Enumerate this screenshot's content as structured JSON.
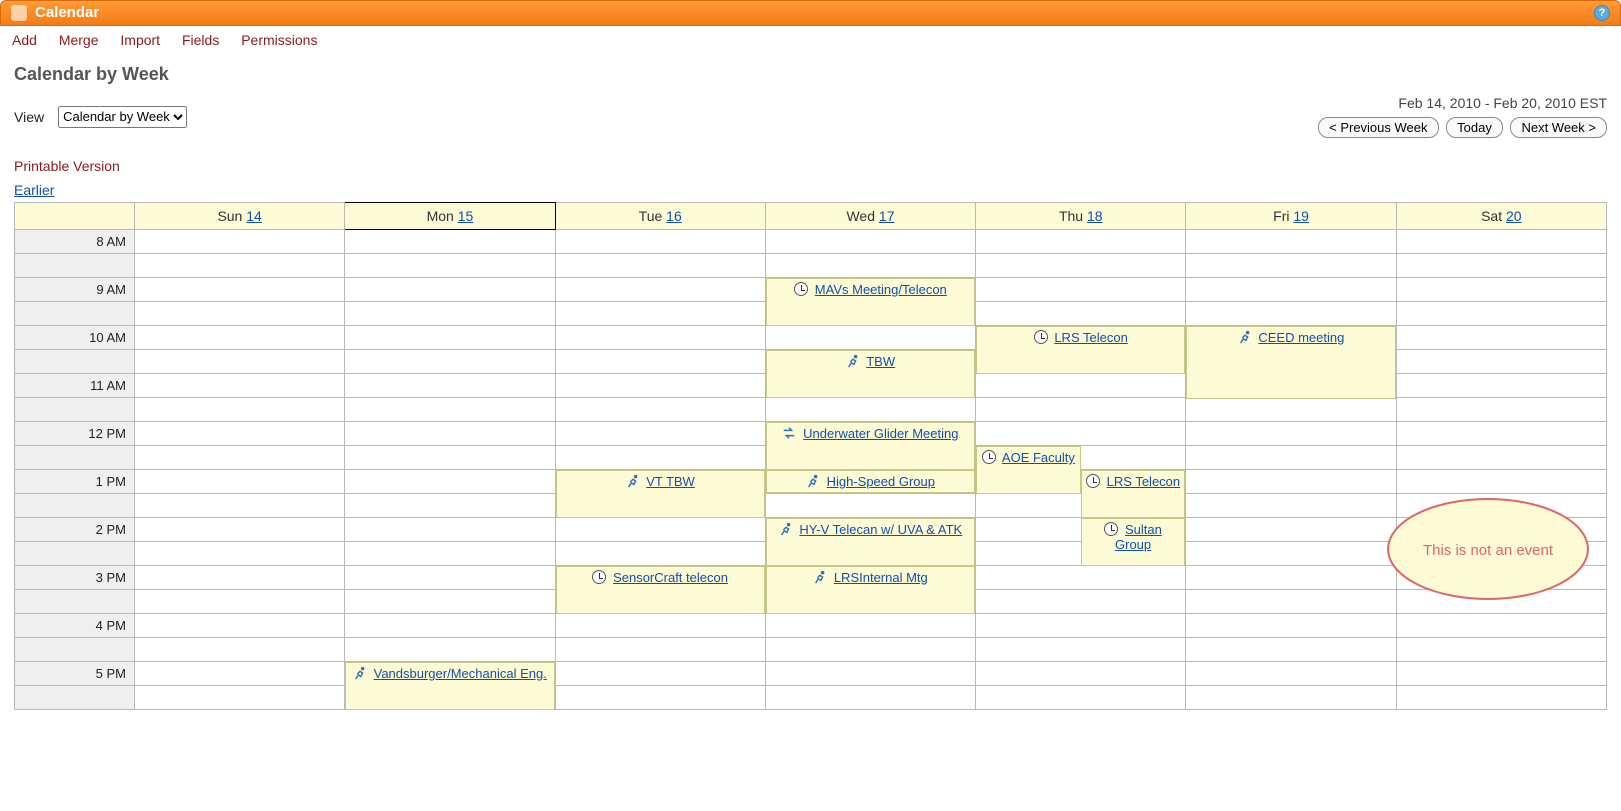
{
  "title": "Calendar",
  "menu": [
    "Add",
    "Merge",
    "Import",
    "Fields",
    "Permissions"
  ],
  "page_title": "Calendar by Week",
  "view_label": "View",
  "view_value": "Calendar by Week",
  "range_text": "Feb 14, 2010 - Feb 20, 2010 EST",
  "nav_prev": "< Previous Week",
  "nav_today": "Today",
  "nav_next": "Next Week >",
  "printable": "Printable Version",
  "earlier": "Earlier",
  "days": [
    {
      "dow": "Sun",
      "num": "14"
    },
    {
      "dow": "Mon",
      "num": "15"
    },
    {
      "dow": "Tue",
      "num": "16"
    },
    {
      "dow": "Wed",
      "num": "17"
    },
    {
      "dow": "Thu",
      "num": "18"
    },
    {
      "dow": "Fri",
      "num": "19"
    },
    {
      "dow": "Sat",
      "num": "20"
    }
  ],
  "hours": [
    "8 AM",
    "9 AM",
    "10 AM",
    "11 AM",
    "12 PM",
    "1 PM",
    "2 PM",
    "3 PM",
    "4 PM",
    "5 PM"
  ],
  "events": [
    {
      "title": "MAVs Meeting/Telecon",
      "icon": "clock",
      "day": 3,
      "row": 2,
      "span": 2
    },
    {
      "title": "LRS Telecon",
      "icon": "clock",
      "day": 4,
      "row": 4,
      "span": 2
    },
    {
      "title": "CEED meeting",
      "icon": "run",
      "day": 5,
      "row": 4,
      "span": 3
    },
    {
      "title": "TBW",
      "icon": "run",
      "day": 3,
      "row": 5,
      "span": 2
    },
    {
      "title": "Underwater Glider Meeting",
      "icon": "swap",
      "day": 3,
      "row": 8,
      "span": 2
    },
    {
      "title": "AOE Faculty",
      "icon": "clock",
      "day": 4,
      "row": 9,
      "span": 2,
      "half": "left"
    },
    {
      "title": "VT TBW",
      "icon": "run",
      "day": 2,
      "row": 10,
      "span": 2
    },
    {
      "title": "High-Speed Group",
      "icon": "run",
      "day": 3,
      "row": 10,
      "span": 1
    },
    {
      "title": "LRS Telecon",
      "icon": "clock",
      "day": 4,
      "row": 10,
      "span": 2,
      "half": "right"
    },
    {
      "title": "HY-V Telecan w/ UVA & ATK",
      "icon": "run",
      "day": 3,
      "row": 12,
      "span": 2
    },
    {
      "title": "Sultan Group",
      "icon": "clock",
      "day": 4,
      "row": 12,
      "span": 2,
      "half": "right"
    },
    {
      "title": "SensorCraft telecon",
      "icon": "clock",
      "day": 2,
      "row": 14,
      "span": 2
    },
    {
      "title": "LRSInternal Mtg",
      "icon": "run",
      "day": 3,
      "row": 14,
      "span": 2
    },
    {
      "title": "Vandsburger/Mechanical Eng.",
      "icon": "run",
      "day": 1,
      "row": 18,
      "span": 2
    }
  ],
  "annotation_text": "This is not an event"
}
